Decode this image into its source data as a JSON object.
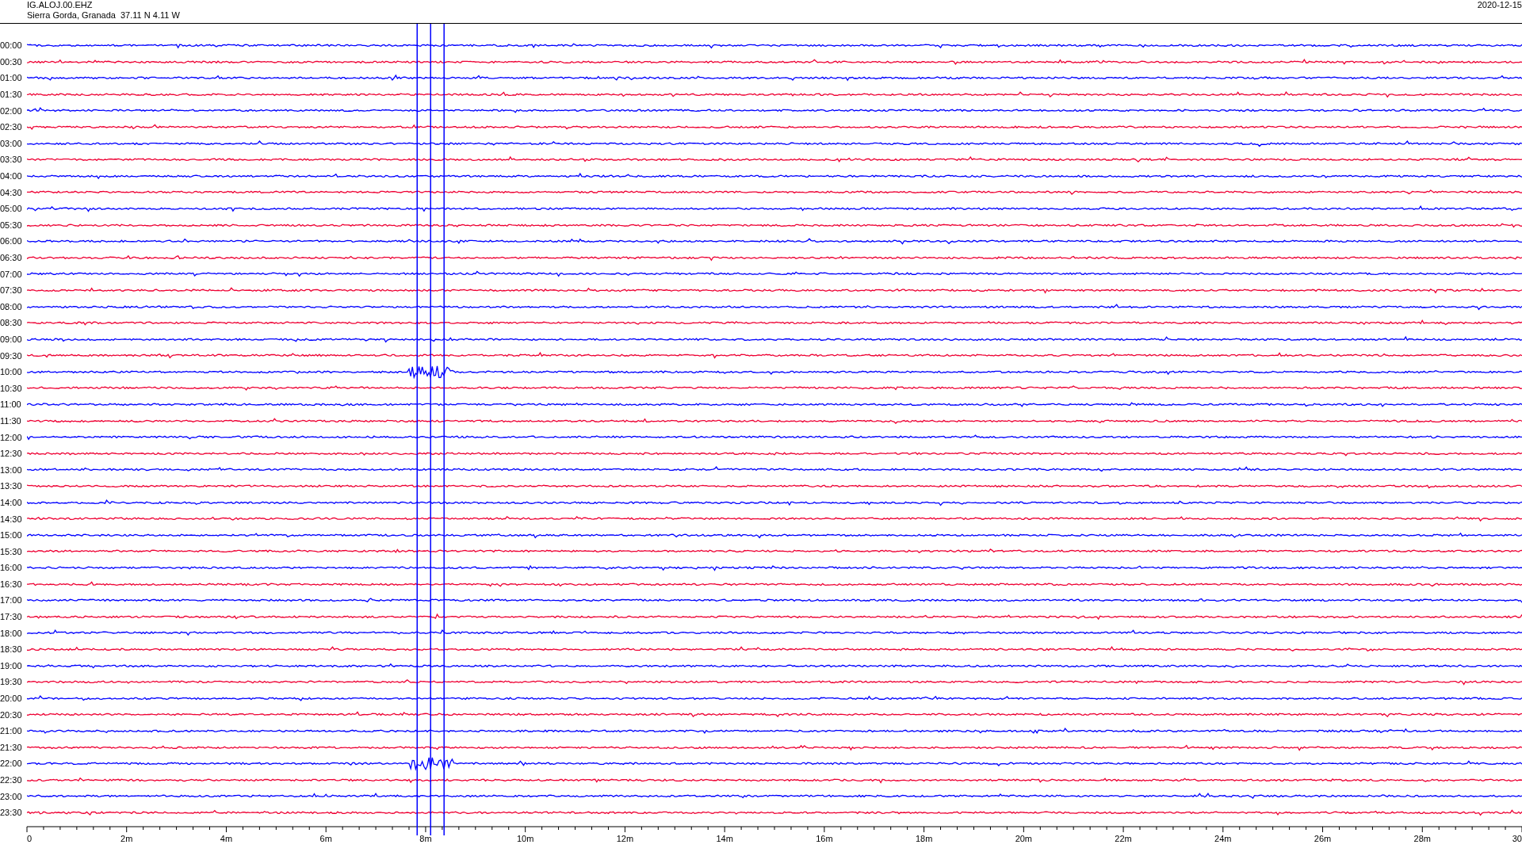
{
  "header": {
    "station": "IG.ALOJ.00.EHZ",
    "location": "Sierra Gorda, Granada  37.11 N 4.11 W",
    "date": "2020-12-15"
  },
  "rows": [
    {
      "label": "00:00",
      "color": "#0000ff"
    },
    {
      "label": "00:30",
      "color": "#ee0033"
    },
    {
      "label": "01:00",
      "color": "#0000ff"
    },
    {
      "label": "01:30",
      "color": "#ee0033"
    },
    {
      "label": "02:00",
      "color": "#0000ff"
    },
    {
      "label": "02:30",
      "color": "#ee0033"
    },
    {
      "label": "03:00",
      "color": "#0000ff"
    },
    {
      "label": "03:30",
      "color": "#ee0033"
    },
    {
      "label": "04:00",
      "color": "#0000ff"
    },
    {
      "label": "04:30",
      "color": "#ee0033"
    },
    {
      "label": "05:00",
      "color": "#0000ff"
    },
    {
      "label": "05:30",
      "color": "#ee0033"
    },
    {
      "label": "06:00",
      "color": "#0000ff"
    },
    {
      "label": "06:30",
      "color": "#ee0033"
    },
    {
      "label": "07:00",
      "color": "#0000ff"
    },
    {
      "label": "07:30",
      "color": "#ee0033"
    },
    {
      "label": "08:00",
      "color": "#0000ff"
    },
    {
      "label": "08:30",
      "color": "#ee0033"
    },
    {
      "label": "09:00",
      "color": "#0000ff"
    },
    {
      "label": "09:30",
      "color": "#ee0033"
    },
    {
      "label": "10:00",
      "color": "#0000ff"
    },
    {
      "label": "10:30",
      "color": "#ee0033"
    },
    {
      "label": "11:00",
      "color": "#0000ff"
    },
    {
      "label": "11:30",
      "color": "#ee0033"
    },
    {
      "label": "12:00",
      "color": "#0000ff"
    },
    {
      "label": "12:30",
      "color": "#ee0033"
    },
    {
      "label": "13:00",
      "color": "#0000ff"
    },
    {
      "label": "13:30",
      "color": "#ee0033"
    },
    {
      "label": "14:00",
      "color": "#0000ff"
    },
    {
      "label": "14:30",
      "color": "#ee0033"
    },
    {
      "label": "15:00",
      "color": "#0000ff"
    },
    {
      "label": "15:30",
      "color": "#ee0033"
    },
    {
      "label": "16:00",
      "color": "#0000ff"
    },
    {
      "label": "16:30",
      "color": "#ee0033"
    },
    {
      "label": "17:00",
      "color": "#0000ff"
    },
    {
      "label": "17:30",
      "color": "#ee0033"
    },
    {
      "label": "18:00",
      "color": "#0000ff"
    },
    {
      "label": "18:30",
      "color": "#ee0033"
    },
    {
      "label": "19:00",
      "color": "#0000ff"
    },
    {
      "label": "19:30",
      "color": "#ee0033"
    },
    {
      "label": "20:00",
      "color": "#0000ff"
    },
    {
      "label": "20:30",
      "color": "#ee0033"
    },
    {
      "label": "21:00",
      "color": "#0000ff"
    },
    {
      "label": "21:30",
      "color": "#ee0033"
    },
    {
      "label": "22:00",
      "color": "#0000ff"
    },
    {
      "label": "22:30",
      "color": "#ee0033"
    },
    {
      "label": "23:00",
      "color": "#0000ff"
    },
    {
      "label": "23:30",
      "color": "#ee0033"
    }
  ],
  "x_axis": {
    "labels": [
      "0",
      "2m",
      "4m",
      "6m",
      "8m",
      "10m",
      "12m",
      "14m",
      "16m",
      "18m",
      "20m",
      "22m",
      "24m",
      "26m",
      "28m",
      "30"
    ]
  }
}
